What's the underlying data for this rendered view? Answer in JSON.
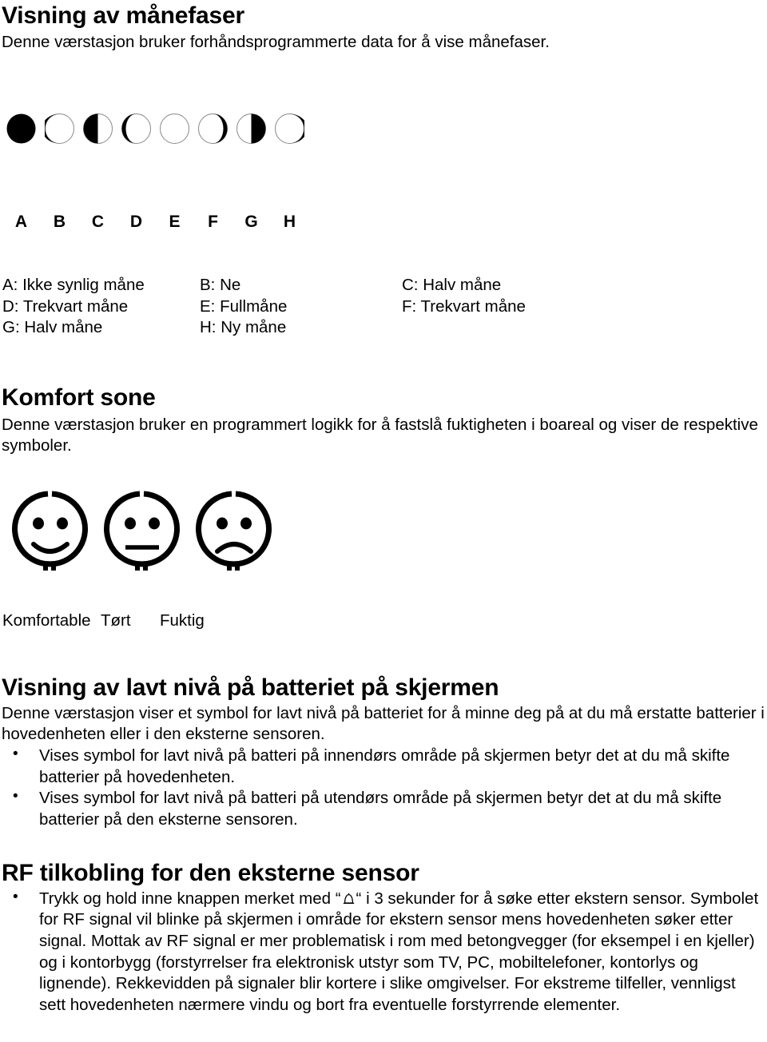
{
  "document": {
    "sections": [
      {
        "id": "moon-phases",
        "heading": "Visning av månefaser",
        "intro": "Denne værstasjon bruker forhåndsprogrammerte data for å vise månefaser."
      },
      {
        "id": "comfort-zone",
        "heading": "Komfort sone",
        "intro": "Denne værstasjon bruker en programmert logikk for å fastslå fuktigheten i boareal og viser de respektive symboler."
      },
      {
        "id": "battery-low",
        "heading": "Visning av lavt nivå på batteriet på skjermen",
        "intro": "Denne værstasjon viser et symbol for lavt nivå på batteriet for å minne deg på at du må erstatte batterier i hovedenheten eller i den eksterne sensoren."
      },
      {
        "id": "rf-connection",
        "heading": "RF tilkobling for den eksterne sensor"
      }
    ]
  },
  "moon": {
    "phases": [
      {
        "letter": "A",
        "icon": "moon-new-dark",
        "fill": "full-dark"
      },
      {
        "letter": "B",
        "icon": "moon-waxing-crescent-dark",
        "fill": "mostly-dark-right-sliver-light"
      },
      {
        "letter": "C",
        "icon": "moon-half-left-dark",
        "fill": "left-half-dark"
      },
      {
        "letter": "D",
        "icon": "moon-waning-crescent-dark",
        "fill": "left-sliver-dark"
      },
      {
        "letter": "E",
        "icon": "moon-full-light",
        "fill": "full-light"
      },
      {
        "letter": "F",
        "icon": "moon-waxing-crescent-right-dark",
        "fill": "right-sliver-dark"
      },
      {
        "letter": "G",
        "icon": "moon-half-right-dark",
        "fill": "right-half-dark"
      },
      {
        "letter": "H",
        "icon": "moon-new-dark-2",
        "fill": "mostly-dark-left-sliver-light"
      }
    ],
    "legend_rows": [
      [
        "A: Ikke synlig måne",
        "B: Ne",
        "C: Halv måne"
      ],
      [
        "D: Trekvart måne",
        "E: Fullmåne",
        "F: Trekvart måne"
      ],
      [
        "G: Halv måne",
        "H: Ny måne",
        ""
      ]
    ]
  },
  "comfort": {
    "faces": [
      {
        "icon": "face-happy-icon",
        "label": "Komfortable"
      },
      {
        "icon": "face-neutral-icon",
        "label": "Tørt"
      },
      {
        "icon": "face-sad-icon",
        "label": "Fuktig"
      }
    ]
  },
  "battery": {
    "bullets": [
      "Vises symbol for lavt nivå på batteri på innendørs område på skjermen betyr det at du må skifte batterier på hovedenheten.",
      "Vises symbol for lavt nivå på batteri på utendørs område på skjermen betyr det at du må skifte batterier på den eksterne sensoren."
    ],
    "bullet_marker": "•"
  },
  "rf": {
    "bullets": [
      {
        "before": "Trykk og hold inne knappen merket med “",
        "icon": "bell-icon",
        "after": "“ i 3 sekunder for å søke etter ekstern sensor. Symbolet for RF signal vil blinke på skjermen i område for ekstern sensor mens hovedenheten søker etter signal. Mottak av RF signal er mer problematisk i rom med betongvegger (for eksempel i en kjeller) og i kontorbygg (forstyrrelser fra elektronisk utstyr som TV, PC, mobiltelefoner, kontorlys og lignende). Rekkevidden på signaler blir kortere i slike omgivelser. For ekstreme tilfeller, vennligst sett hovedenheten nærmere vindu og bort fra eventuelle forstyrrende elementer."
      }
    ],
    "bullet_marker": "•"
  },
  "colors": {
    "ink": "#000000",
    "paper": "#ffffff",
    "outline": "#777777"
  }
}
